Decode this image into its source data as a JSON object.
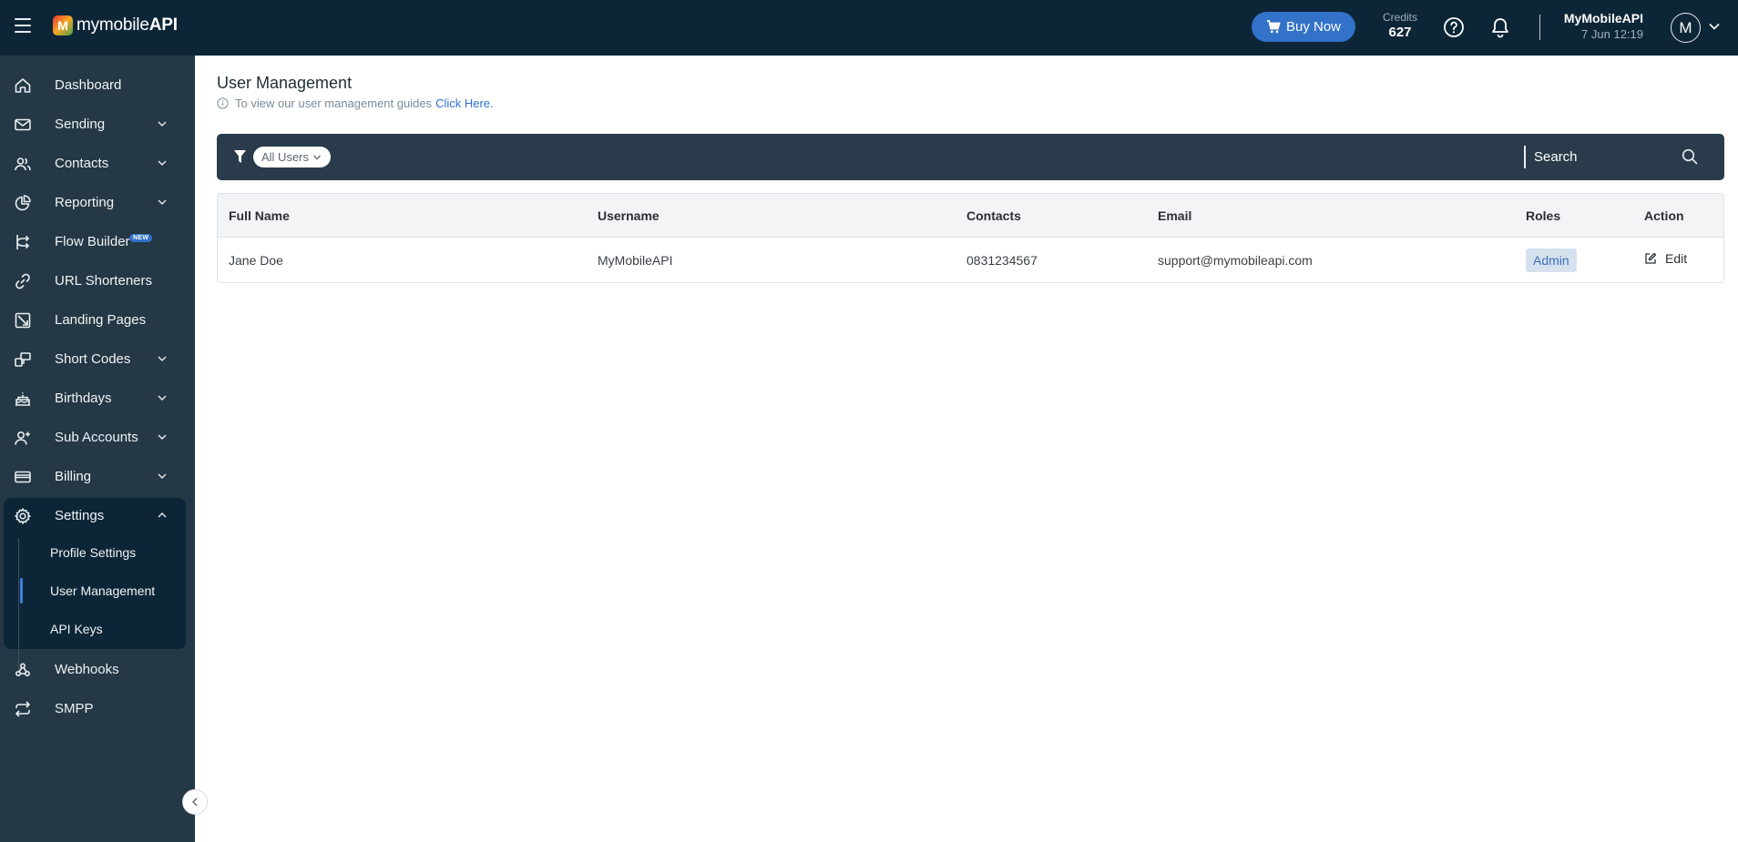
{
  "brand": {
    "logo_mark": "M",
    "logo_text_light": "mymobile",
    "logo_text_bold": "API"
  },
  "header": {
    "buy_now_label": "Buy Now",
    "credits_label": "Credits",
    "credits_value": "627",
    "account_name": "MyMobileAPI",
    "account_date": "7 Jun 12:19",
    "avatar_initial": "M"
  },
  "sidebar": {
    "items": [
      {
        "label": "Dashboard",
        "icon": "home-icon"
      },
      {
        "label": "Sending",
        "icon": "mail-icon"
      },
      {
        "label": "Contacts",
        "icon": "users-icon"
      },
      {
        "label": "Reporting",
        "icon": "pie-chart-icon"
      },
      {
        "label": "Flow Builder",
        "icon": "flow-icon",
        "badge": "NEW"
      },
      {
        "label": "URL Shorteners",
        "icon": "link-icon"
      },
      {
        "label": "Landing Pages",
        "icon": "landing-page-icon"
      },
      {
        "label": "Short Codes",
        "icon": "short-codes-icon"
      },
      {
        "label": "Birthdays",
        "icon": "cake-icon"
      },
      {
        "label": "Sub Accounts",
        "icon": "user-plus-icon"
      },
      {
        "label": "Billing",
        "icon": "credit-card-icon"
      },
      {
        "label": "Settings",
        "icon": "gear-icon"
      },
      {
        "label": "Webhooks",
        "icon": "webhook-icon"
      },
      {
        "label": "SMPP",
        "icon": "repeat-icon"
      }
    ],
    "settings_sub": [
      {
        "label": "Profile Settings"
      },
      {
        "label": "User Management"
      },
      {
        "label": "API Keys"
      }
    ]
  },
  "main": {
    "title": "User Management",
    "guide_text": "To view our user management guides",
    "guide_link": "Click Here.",
    "filter_label": "All Users",
    "search_placeholder": "Search",
    "table": {
      "headers": [
        "Full Name",
        "Username",
        "Contacts",
        "Email",
        "Roles",
        "Action"
      ],
      "rows": [
        {
          "full_name": "Jane Doe",
          "username": "MyMobileAPI",
          "contacts": "0831234567",
          "email": "support@mymobileapi.com",
          "role": "Admin",
          "action": "Edit"
        }
      ]
    }
  },
  "colors": {
    "topbar": "#0d2637",
    "sidebar": "#243845",
    "accent": "#3272c8",
    "filterbar": "#2a3c4b"
  }
}
